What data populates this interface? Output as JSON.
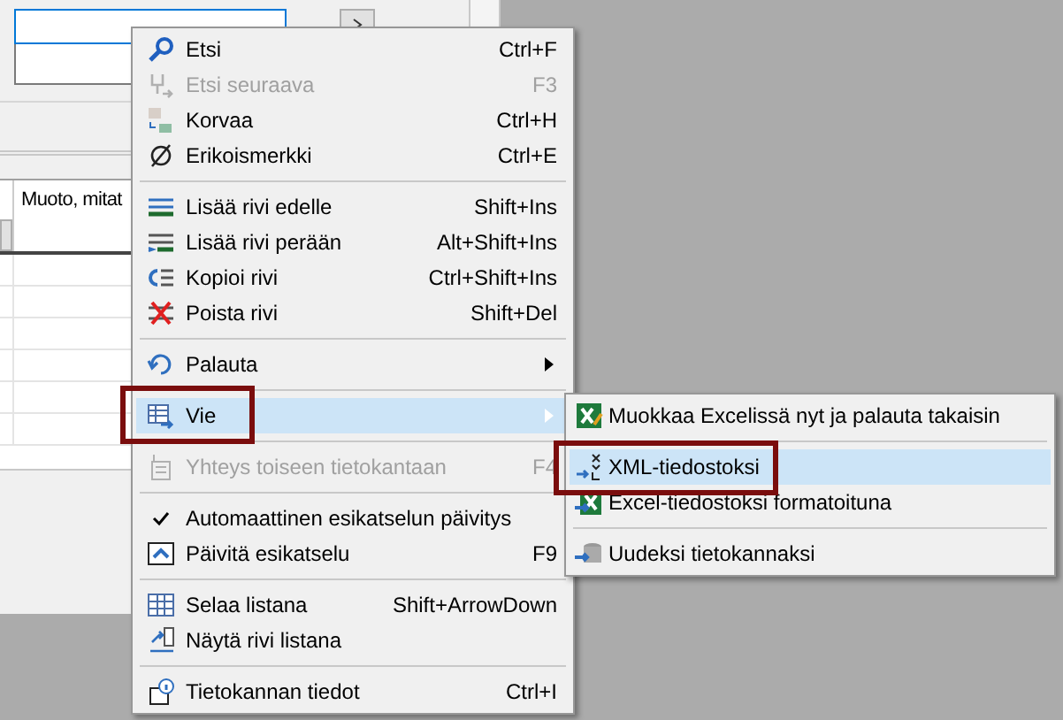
{
  "background_window": {
    "table": {
      "columns": [
        "Muoto, mitat"
      ]
    }
  },
  "context_menu": {
    "items": [
      {
        "kind": "item",
        "label": "Etsi",
        "shortcut": "Ctrl+F",
        "disabled": false,
        "checked": false,
        "selected": false,
        "has_submenu": false
      },
      {
        "kind": "item",
        "label": "Etsi seuraava",
        "shortcut": "F3",
        "disabled": true,
        "checked": false,
        "selected": false,
        "has_submenu": false
      },
      {
        "kind": "item",
        "label": "Korvaa",
        "shortcut": "Ctrl+H",
        "disabled": false,
        "checked": false,
        "selected": false,
        "has_submenu": false
      },
      {
        "kind": "item",
        "label": "Erikoismerkki",
        "shortcut": "Ctrl+E",
        "disabled": false,
        "checked": false,
        "selected": false,
        "has_submenu": false
      },
      {
        "kind": "separator"
      },
      {
        "kind": "item",
        "label": "Lisää rivi edelle",
        "shortcut": "Shift+Ins",
        "disabled": false,
        "checked": false,
        "selected": false,
        "has_submenu": false
      },
      {
        "kind": "item",
        "label": "Lisää rivi perään",
        "shortcut": "Alt+Shift+Ins",
        "disabled": false,
        "checked": false,
        "selected": false,
        "has_submenu": false
      },
      {
        "kind": "item",
        "label": "Kopioi rivi",
        "shortcut": "Ctrl+Shift+Ins",
        "disabled": false,
        "checked": false,
        "selected": false,
        "has_submenu": false
      },
      {
        "kind": "item",
        "label": "Poista rivi",
        "shortcut": "Shift+Del",
        "disabled": false,
        "checked": false,
        "selected": false,
        "has_submenu": false
      },
      {
        "kind": "separator"
      },
      {
        "kind": "item",
        "label": "Palauta",
        "disabled": false,
        "checked": false,
        "selected": false,
        "has_submenu": true
      },
      {
        "kind": "separator"
      },
      {
        "kind": "item",
        "label": "Vie",
        "disabled": false,
        "checked": false,
        "selected": true,
        "has_submenu": true
      },
      {
        "kind": "separator"
      },
      {
        "kind": "item",
        "label": "Yhteys toiseen tietokantaan",
        "shortcut": "F4",
        "disabled": true,
        "checked": false,
        "selected": false,
        "has_submenu": false
      },
      {
        "kind": "separator"
      },
      {
        "kind": "item",
        "label": "Automaattinen esikatselun päivitys",
        "disabled": false,
        "checked": true,
        "selected": false,
        "has_submenu": false
      },
      {
        "kind": "item",
        "label": "Päivitä esikatselu",
        "shortcut": "F9",
        "disabled": false,
        "checked": false,
        "selected": false,
        "has_submenu": false
      },
      {
        "kind": "separator"
      },
      {
        "kind": "item",
        "label": "Selaa listana",
        "shortcut": "Shift+ArrowDown",
        "disabled": false,
        "checked": false,
        "selected": false,
        "has_submenu": false
      },
      {
        "kind": "item",
        "label": "Näytä rivi listana",
        "disabled": false,
        "checked": false,
        "selected": false,
        "has_submenu": false
      },
      {
        "kind": "separator"
      },
      {
        "kind": "item",
        "label": "Tietokannan tiedot",
        "shortcut": "Ctrl+I",
        "disabled": false,
        "checked": false,
        "selected": false,
        "has_submenu": false
      }
    ]
  },
  "submenu": {
    "items": [
      {
        "kind": "item",
        "label": "Muokkaa Excelissä nyt ja palauta takaisin",
        "selected": false
      },
      {
        "kind": "separator"
      },
      {
        "kind": "item",
        "label": "XML-tiedostoksi",
        "selected": true
      },
      {
        "kind": "item",
        "label": "Excel-tiedostoksi formatoituna",
        "selected": false
      },
      {
        "kind": "separator"
      },
      {
        "kind": "item",
        "label": "Uudeksi tietokannaksi",
        "selected": false
      }
    ]
  }
}
